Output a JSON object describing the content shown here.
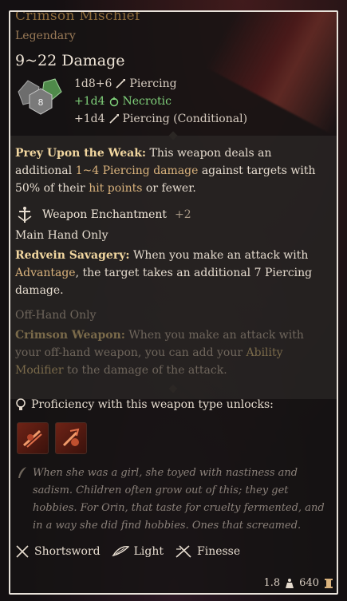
{
  "item": {
    "name": "Crimson Mischief",
    "rarity": "Legendary",
    "damage_range": "9~22 Damage",
    "rolls": [
      {
        "dice": "1d8+6",
        "type": "Piercing",
        "icon": "piercing-icon",
        "color": "#d7ccc0"
      },
      {
        "dice": "+1d4",
        "type": "Necrotic",
        "icon": "necrotic-icon",
        "color": "#7fd07a"
      },
      {
        "dice": "+1d4",
        "type": "Piercing (Conditional)",
        "icon": "piercing-icon",
        "color": "#d7ccc0"
      }
    ],
    "dice_icon_value": "8"
  },
  "prey": {
    "title": "Prey Upon the Weak:",
    "text_a": " This weapon deals an additional ",
    "highlight": "1~4 Piercing damage",
    "text_b": " against targets with 50% of their ",
    "highlight2": "hit points",
    "text_c": " or fewer."
  },
  "enchant": {
    "label": "Weapon Enchantment",
    "bonus": "+2"
  },
  "main_hand": {
    "label": "Main Hand Only",
    "title": "Redvein Savagery:",
    "text_a": " When you make an attack with ",
    "highlight": "Advantage",
    "text_b": ", the target takes an additional 7 Piercing damage."
  },
  "off_hand": {
    "label": "Off-Hand Only",
    "title": "Crimson Weapon:",
    "text_a": " When you make an attack with your off-hand weapon, you can add your ",
    "highlight": "Ability Modifier",
    "text_b": " to the damage of the attack."
  },
  "proficiency": {
    "label": "Proficiency with this weapon type unlocks:",
    "unlocks": [
      "slash-action-icon",
      "pommel-strike-icon"
    ]
  },
  "lore": "When she was a girl, she toyed with nastiness and sadism. Children often grow out of this; they get hobbies. For Orin, that taste for cruelty fermented, and in a way she did find hobbies. Ones that screamed.",
  "properties": [
    {
      "label": "Shortsword",
      "icon": "shortsword-icon"
    },
    {
      "label": "Light",
      "icon": "light-icon"
    },
    {
      "label": "Finesse",
      "icon": "finesse-icon"
    }
  ],
  "footer": {
    "weight": "1.8",
    "value": "640"
  },
  "colors": {
    "title": "#b88b4a",
    "highlight": "#d9b27c",
    "necrotic": "#7fd07a",
    "frame": "#e8e2da"
  }
}
